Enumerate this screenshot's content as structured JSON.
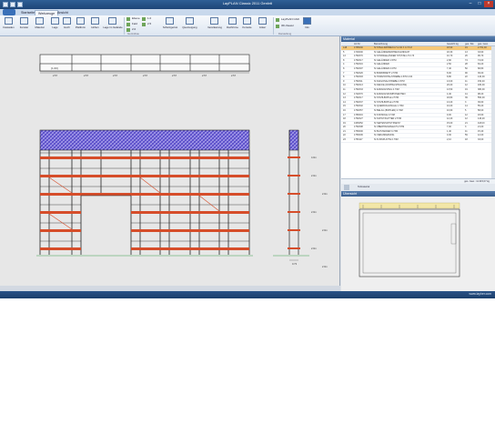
{
  "app": {
    "title": "LayPLAN Classic 2011 GenIntl"
  },
  "tabs": [
    "Startseite",
    "Werkzeuge",
    "Ansicht"
  ],
  "ribbon": {
    "buttons": [
      "Fassaden",
      "Fenster",
      "Material",
      "Lage",
      "Hoch",
      "Plattform",
      "Höhen",
      "Lage im Gelände",
      "Ebene",
      "Schutzgerüst",
      "Verankerung",
      "Querneigung",
      "Dachrinne",
      "Konsole",
      "Anker",
      "LayPLAN CAD",
      "3D-Viewer",
      "Info"
    ],
    "small_labels": [
      "Ebene",
      "Feld",
      "2.0",
      "1.0",
      "2.5"
    ],
    "groups": [
      "Gerüstbau",
      "Darstellung"
    ]
  },
  "canvas": {
    "top_dim_left": "(1.00)",
    "top_dims": [
      "2.57",
      "2.57",
      "2.57",
      "2.57",
      "2.57",
      "2.57",
      "2.57",
      "2.57"
    ],
    "heights": [
      "4.0m",
      "2.0m",
      "2.0m",
      "2.0m",
      "2.0m",
      "2.0m",
      "2.0m"
    ],
    "side_dim": "0.73"
  },
  "material": {
    "title": "Material",
    "columns": [
      "",
      "Art.Nr",
      "Bezeichnung",
      "Gewicht kg",
      "ges. Stk.",
      "ges. Gew."
    ],
    "rows": [
      [
        "148",
        "1765000",
        "SI STELLRAHMEN LH 2.00 X 0.73 M",
        "18,90",
        "19",
        "2.761,40"
      ],
      [
        "5",
        "1740000",
        "SI GELÄNDERRAHMEN EINFACH",
        "18,30",
        "13",
        "33,60"
      ],
      [
        "13",
        "1752070",
        "SI STIRNGELÄNDER STÜTZE LH 0.73",
        "10,70",
        "26",
        "99,70"
      ],
      [
        "8",
        "1752017",
        "SI GELÄNDER 1.57M",
        "2,90",
        "74",
        "74,00"
      ],
      [
        "4",
        "1752016",
        "SI GELÄNDER",
        "2,50",
        "28",
        "84,20"
      ],
      [
        "8",
        "1752097",
        "SI GELÄNDER 2.07M",
        "7,40",
        "50",
        "68,80"
      ],
      [
        "7",
        "1752026",
        "SI BORDBRETT 2.57M",
        "8,00",
        "90",
        "36,00"
      ],
      [
        "8",
        "1752093",
        "SI HORIZONTALSTREBE 2.57M 2.00",
        "8,80",
        "22",
        "140,00"
      ],
      [
        "9",
        "1752011",
        "SI DIAGONALSTREBE 2.57M",
        "13,00",
        "11",
        "150,40"
      ],
      [
        "10",
        "1752013",
        "SI DECKE (DOPPELSTRAUSS)",
        "20,00",
        "12",
        "180,00"
      ],
      [
        "11",
        "1752033",
        "SI ANFANGSTEIL 0.73M",
        "13,50",
        "19",
        "380,00"
      ],
      [
        "12",
        "1742070",
        "SI ANFANGSKOMPONENTEN",
        "4,40",
        "41",
        "98,20"
      ],
      [
        "13",
        "1752017",
        "SI STAHLBOHLE 2.57M",
        "18,80",
        "39",
        "550,00"
      ],
      [
        "14",
        "1752037",
        "SI STAHLBOHLE 2.57M",
        "13,20",
        "3",
        "39,60"
      ],
      [
        "15",
        "1752002",
        "SI QUERDIAGONALE 1.73M",
        "10,00",
        "14",
        "55,20"
      ],
      [
        "16",
        "1752057",
        "SI BELAG (BOHLEN) 0.73M",
        "10,60",
        "5",
        "58,00"
      ],
      [
        "17",
        "1780016",
        "SI KONSOLE 0.73M",
        "9,00",
        "12",
        "18,60"
      ],
      [
        "18",
        "1752027",
        "SI SCHUTZGITTER 2.57M",
        "12,20",
        "12",
        "146,20"
      ],
      [
        "19",
        "4153052",
        "SI SEITENSCHUTZNETZ",
        "15,00",
        "21",
        "118,00"
      ],
      [
        "20",
        "1752098",
        "SI ÜBERHANGBLECH 2.57M",
        "7,00",
        "3",
        "21,00"
      ],
      [
        "21",
        "1750000",
        "SI BLITZANKER 0.73M",
        "1,40",
        "11",
        "15,40"
      ],
      [
        "22",
        "1750006",
        "SI VERANKERUNG",
        "0,30",
        "59",
        "12,00"
      ],
      [
        "23",
        "1750117",
        "SI FUSSPLATTE 0.73M",
        "2,10",
        "18",
        "33,00"
      ]
    ],
    "total": "ges. Gew.: 11.315,07 kg",
    "sub_label": "Teilmaterial"
  },
  "preview": {
    "title": "Übersicht"
  },
  "status": {
    "right": "www.layher.com"
  }
}
